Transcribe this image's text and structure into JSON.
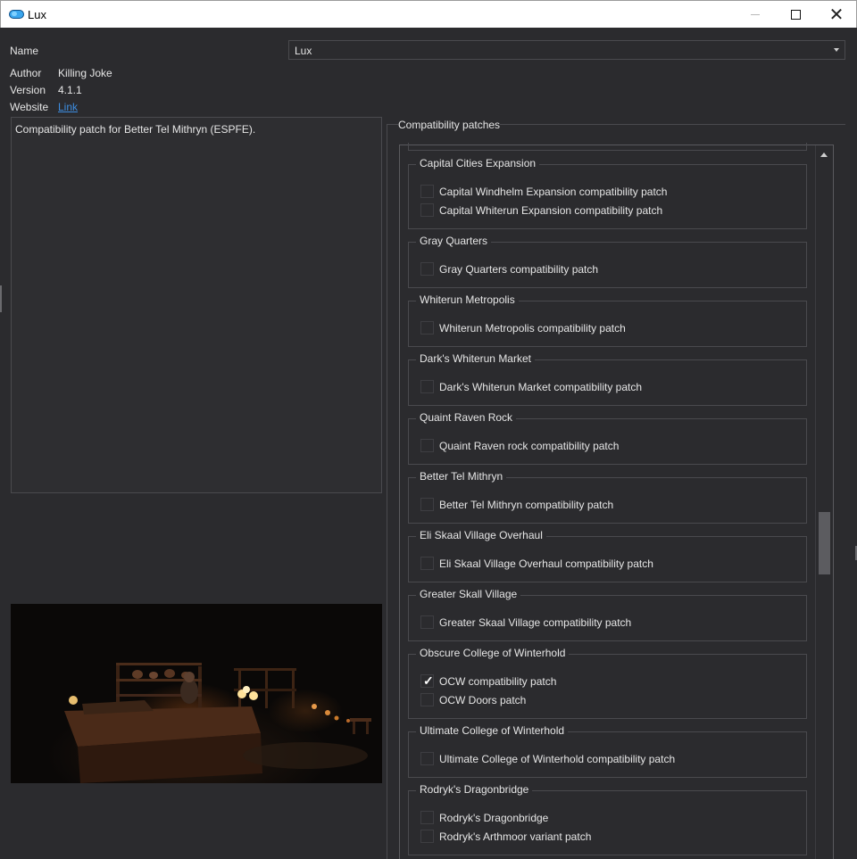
{
  "window": {
    "title": "Lux",
    "minimize": "–",
    "maximize": "□",
    "close": "✕"
  },
  "info": {
    "name_label": "Name",
    "name_value": "Lux",
    "author_label": "Author",
    "author_value": "Killing Joke",
    "version_label": "Version",
    "version_value": "4.1.1",
    "website_label": "Website",
    "website_value": "Link",
    "description": "Compatibility patch for Better Tel Mithryn (ESPFE)."
  },
  "patches": {
    "title": "Compatibility patches",
    "groups": [
      {
        "title": "Capital Cities Expansion",
        "options": [
          {
            "label": "Capital Windhelm Expansion compatibility patch",
            "checked": false
          },
          {
            "label": "Capital Whiterun Expansion compatibility patch",
            "checked": false
          }
        ]
      },
      {
        "title": "Gray Quarters",
        "options": [
          {
            "label": "Gray Quarters compatibility patch",
            "checked": false
          }
        ]
      },
      {
        "title": "Whiterun Metropolis",
        "options": [
          {
            "label": "Whiterun Metropolis compatibility patch",
            "checked": false
          }
        ]
      },
      {
        "title": "Dark's Whiterun Market",
        "options": [
          {
            "label": "Dark's Whiterun Market compatibility patch",
            "checked": false
          }
        ]
      },
      {
        "title": "Quaint Raven Rock",
        "options": [
          {
            "label": "Quaint Raven rock compatibility patch",
            "checked": false
          }
        ]
      },
      {
        "title": "Better Tel Mithryn",
        "options": [
          {
            "label": "Better Tel Mithryn compatibility patch",
            "checked": false
          }
        ]
      },
      {
        "title": "Eli Skaal Village Overhaul",
        "options": [
          {
            "label": "Eli Skaal Village Overhaul compatibility patch",
            "checked": false
          }
        ]
      },
      {
        "title": "Greater Skall Village",
        "options": [
          {
            "label": "Greater Skaal Village compatibility patch",
            "checked": false
          }
        ]
      },
      {
        "title": "Obscure College of Winterhold",
        "options": [
          {
            "label": "OCW compatibility patch",
            "checked": true
          },
          {
            "label": "OCW Doors patch",
            "checked": false
          }
        ]
      },
      {
        "title": "Ultimate College of Winterhold",
        "options": [
          {
            "label": "Ultimate College of Winterhold compatibility patch",
            "checked": false
          }
        ]
      },
      {
        "title": "Rodryk's Dragonbridge",
        "options": [
          {
            "label": "Rodryk's Dragonbridge",
            "checked": false
          },
          {
            "label": "Rodryk's Arthmoor variant patch",
            "checked": false
          }
        ]
      }
    ]
  }
}
